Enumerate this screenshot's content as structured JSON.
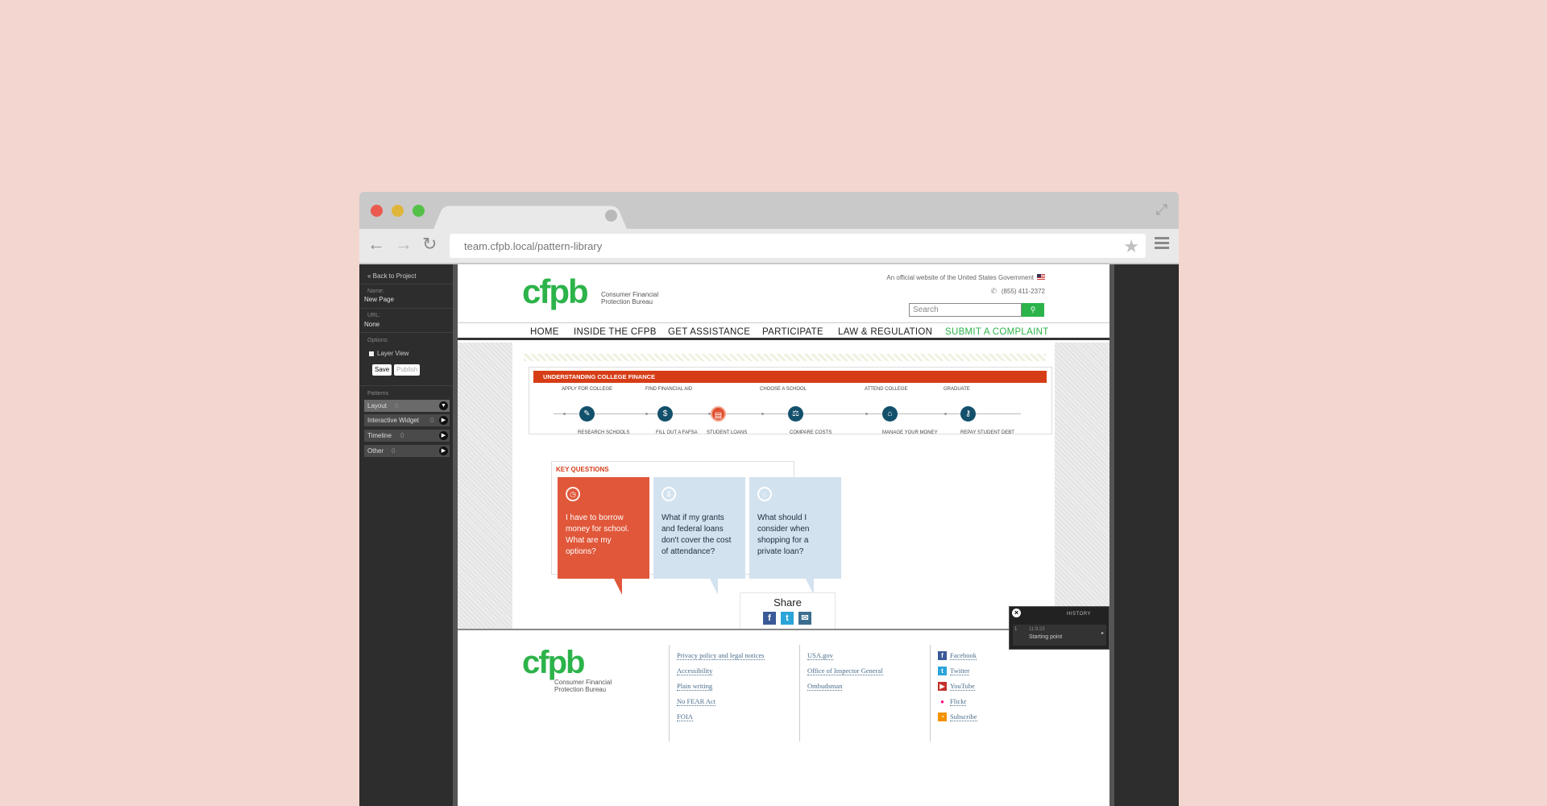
{
  "browser": {
    "url": "team.cfpb.local/pattern-library"
  },
  "sidebar": {
    "back_link": "« Back to Project",
    "name_label": "Name:",
    "name_value": "New Page",
    "url_label": "URL:",
    "url_value": "None",
    "options_label": "Options:",
    "layer_view": "Layer View",
    "save": "Save",
    "publish": "Publish",
    "patterns_label": "Patterns",
    "patterns": [
      {
        "label": "Layout",
        "count": "0"
      },
      {
        "label": "Interactive Widget",
        "count": "0"
      },
      {
        "label": "Timeline",
        "count": "0"
      },
      {
        "label": "Other",
        "count": "0"
      }
    ]
  },
  "header": {
    "logo": "cfpb",
    "logo_sub_1": "Consumer Financial",
    "logo_sub_2": "Protection Bureau",
    "official": "An official website of the United States Government",
    "phone": "(855) 411-2372",
    "search_placeholder": "Search"
  },
  "nav": {
    "items": [
      "HOME",
      "INSIDE THE CFPB",
      "GET ASSISTANCE",
      "PARTICIPATE",
      "LAW & REGULATION",
      "SUBMIT A COMPLAINT"
    ]
  },
  "finance": {
    "title": "UNDERSTANDING COLLEGE FINANCE",
    "top_steps": [
      "APPLY FOR COLLEGE",
      "FIND FINANCIAL AID",
      "CHOOSE A SCHOOL",
      "ATTEND COLLEGE",
      "GRADUATE"
    ],
    "bottom_steps": [
      "RESEARCH SCHOOLS",
      "FILL OUT A FAFSA",
      "STUDENT LOANS",
      "COMPARE COSTS",
      "MANAGE YOUR MONEY",
      "REPAY STUDENT DEBT"
    ]
  },
  "key_questions": {
    "title": "KEY QUESTIONS",
    "cards": [
      {
        "text": "I have to borrow money for school. What are my options?",
        "icon": "clock-icon"
      },
      {
        "text": "What if my grants and federal loans don't cover the cost of attendance?",
        "icon": "dollar-icon"
      },
      {
        "text": "What should I consider when shopping for a private loan?",
        "icon": "bank-icon"
      }
    ]
  },
  "share": {
    "title": "Share"
  },
  "footer": {
    "col1": [
      "Privacy policy and legal notices",
      "Accessibility",
      "Plain writing",
      "No FEAR Act",
      "FOIA"
    ],
    "col2": [
      "USA.gov",
      "Office of Inspector General",
      "Ombudsman"
    ],
    "social": [
      "Facebook",
      "Twitter",
      "YouTube",
      "Flickr",
      "Subscribe"
    ]
  },
  "history": {
    "title": "HISTORY",
    "entry_num": "1",
    "entry_time": "11:9:23",
    "entry_label": "Starting point"
  },
  "colors": {
    "brand_green": "#2cb34a",
    "accent_orange": "#d63d17",
    "card_blue": "#d3e2ef",
    "navy": "#13506b"
  }
}
